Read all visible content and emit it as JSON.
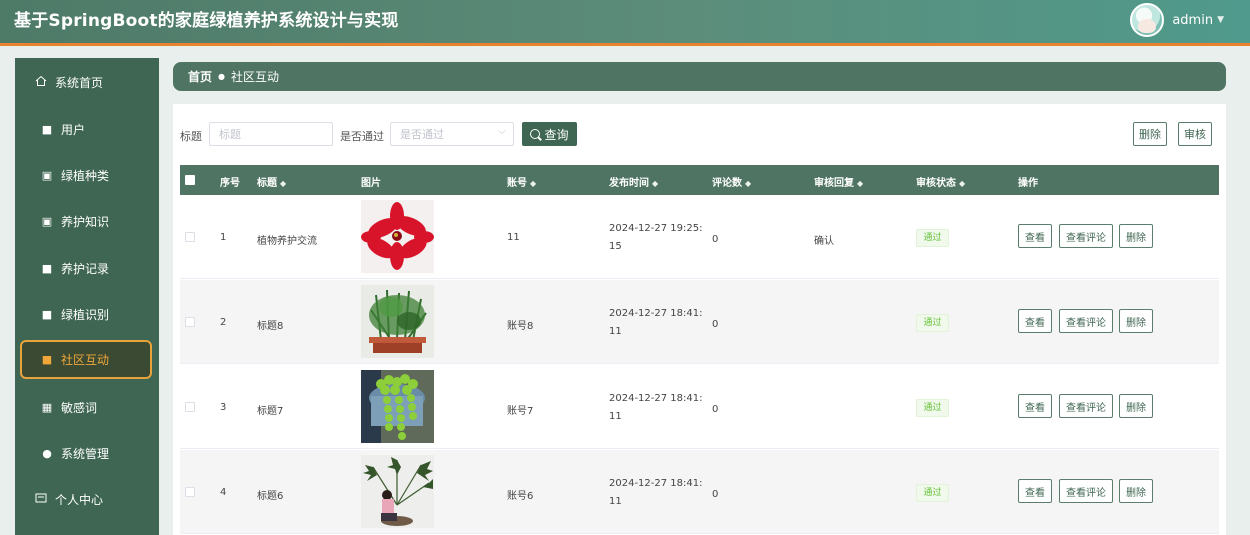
{
  "header": {
    "app_title": "基于SpringBoot的家庭绿植养护系统设计与实现",
    "user_name": "admin",
    "avatar_icon": "user-avatar",
    "accent_color": "#e8822e"
  },
  "sidebar": {
    "home_label": "系统首页",
    "items": [
      {
        "label": "用户",
        "icon": "grid-icon"
      },
      {
        "label": "绿植种类",
        "icon": "clipboard-icon"
      },
      {
        "label": "养护知识",
        "icon": "clipboard-icon"
      },
      {
        "label": "养护记录",
        "icon": "grid-icon"
      },
      {
        "label": "绿植识别",
        "icon": "grid-icon"
      },
      {
        "label": "社区互动",
        "icon": "grid-icon"
      },
      {
        "label": "敏感词",
        "icon": "table-icon"
      },
      {
        "label": "系统管理",
        "icon": "user-icon"
      }
    ],
    "personal_label": "个人中心",
    "active_index": 5
  },
  "breadcrumb": {
    "home": "首页",
    "current": "社区互动"
  },
  "search": {
    "title_label": "标题",
    "title_placeholder": "标题",
    "approved_label": "是否通过",
    "approved_placeholder": "是否通过",
    "query_button": "查询",
    "delete_button": "删除",
    "review_button": "审核"
  },
  "table": {
    "columns": {
      "index": "序号",
      "title": "标题",
      "image": "图片",
      "account": "账号",
      "publish_time": "发布时间",
      "comments": "评论数",
      "review_reply": "审核回复",
      "review_status": "审核状态",
      "actions": "操作"
    },
    "rows": [
      {
        "index": "1",
        "title": "植物养护交流",
        "account": "11",
        "publish_time": "2024-12-27 19:25:15",
        "comments": "0",
        "review_reply": "确认",
        "review_status": "通过",
        "image": "red-poinsettia"
      },
      {
        "index": "2",
        "title": "标题8",
        "account": "账号8",
        "publish_time": "2024-12-27 18:41:11",
        "comments": "0",
        "review_reply": "",
        "review_status": "通过",
        "image": "bonsai-pine"
      },
      {
        "index": "3",
        "title": "标题7",
        "account": "账号7",
        "publish_time": "2024-12-27 18:41:11",
        "comments": "0",
        "review_reply": "",
        "review_status": "通过",
        "image": "string-of-pearls"
      },
      {
        "index": "4",
        "title": "标题6",
        "account": "账号6",
        "publish_time": "2024-12-27 18:41:11",
        "comments": "0",
        "review_reply": "",
        "review_status": "通过",
        "image": "philodendron-person"
      }
    ],
    "action_labels": {
      "view": "查看",
      "view_comments": "查看评论",
      "delete": "删除"
    }
  }
}
